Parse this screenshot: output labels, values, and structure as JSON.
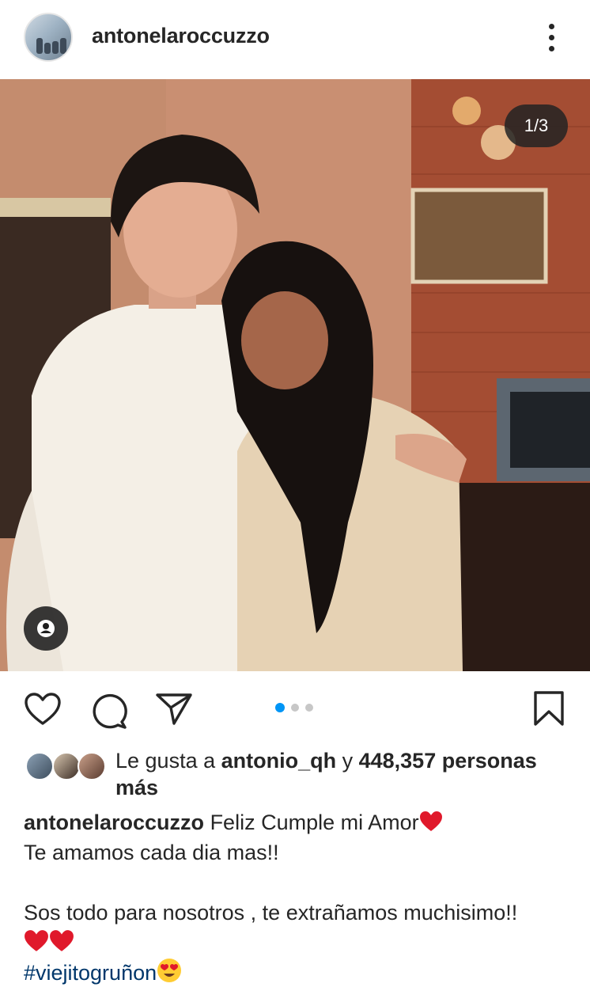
{
  "post": {
    "username": "antonelaroccuzzo",
    "image_counter": "1/3",
    "carousel": {
      "total": 3,
      "active_index": 0
    }
  },
  "likes": {
    "prefix": "Le gusta a ",
    "liker": "antonio_qh",
    "connector": " y ",
    "count_text": "448,357 personas más"
  },
  "caption": {
    "username": "antonelaroccuzzo",
    "line1": "Feliz Cumple mi Amor",
    "line2": "Te amamos cada dia mas!!",
    "line3": "Sos todo para nosotros , te extrañamos muchisimo!!",
    "hashtag": "#viejitogruñon"
  },
  "icons": [
    "more-options-icon",
    "user-tag-icon",
    "like-icon",
    "comment-icon",
    "share-icon",
    "save-icon",
    "heart-emoji-icon",
    "heart-eyes-emoji-icon"
  ],
  "colors": {
    "text": "#262626",
    "accent": "#0095f6",
    "hashtag": "#00376b",
    "heart": "#e0192b"
  }
}
